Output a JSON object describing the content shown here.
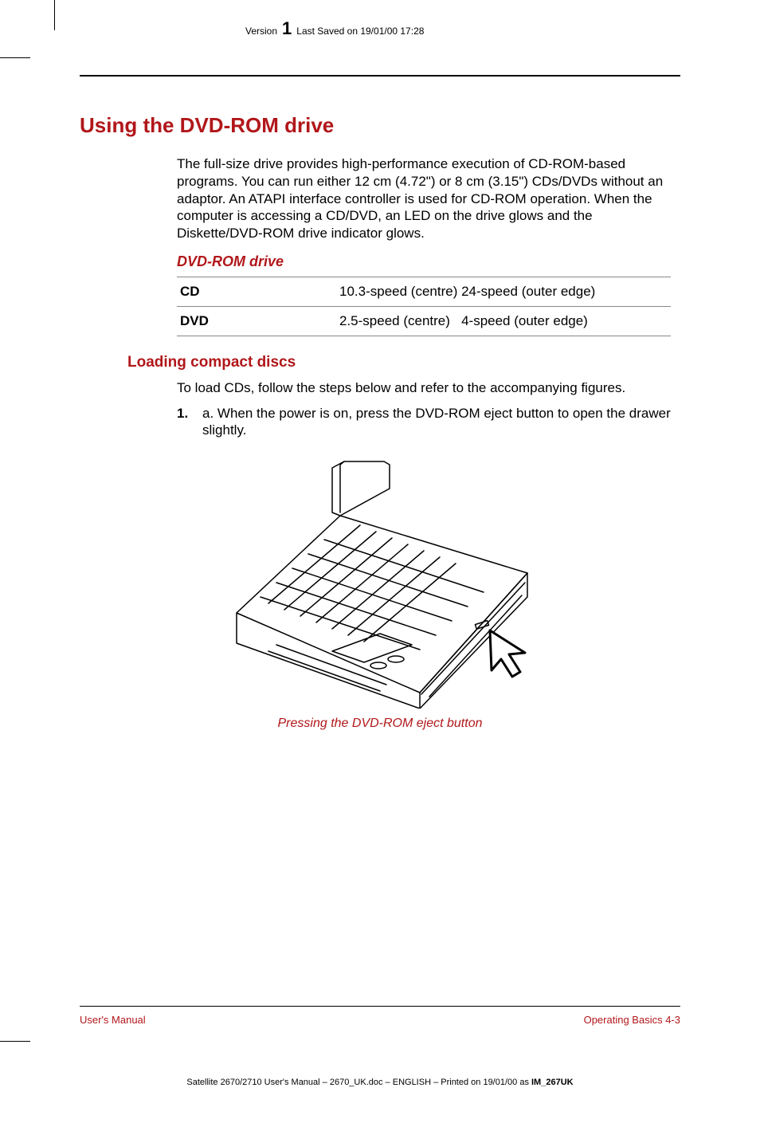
{
  "header": {
    "version_label": "Version",
    "version_number": "1",
    "saved": "Last Saved on 19/01/00 17:28"
  },
  "section": {
    "title": "Using the DVD-ROM drive",
    "intro": "The full-size drive provides high-performance execution of CD-ROM-based programs. You can run either 12 cm (4.72\") or 8 cm (3.15\") CDs/DVDs without an adaptor. An ATAPI interface controller is used for CD-ROM operation. When the computer is accessing a CD/DVD, an LED on the drive glows and the Diskette/DVD-ROM drive indicator glows.",
    "spec_title": "DVD-ROM drive",
    "specs": [
      {
        "label": "CD",
        "value": "10.3-speed (centre) 24-speed (outer edge)"
      },
      {
        "label": "DVD",
        "value": "2.5-speed (centre)   4-speed (outer edge)"
      }
    ],
    "sub_title": "Loading compact discs",
    "sub_intro": "To load CDs, follow the steps below and refer to the accompanying figures.",
    "step_number": "1.",
    "step_text": "a.  When the power is on, press the DVD-ROM eject button to open the drawer slightly.",
    "figure_caption": "Pressing the DVD-ROM eject button"
  },
  "footer": {
    "left": "User's Manual",
    "right": "Operating Basics  4-3",
    "imprint_a": "Satellite 2670/2710 User's Manual  – 2670_UK.doc – ENGLISH – Printed on 19/01/00 as ",
    "imprint_b": "IM_267UK"
  }
}
